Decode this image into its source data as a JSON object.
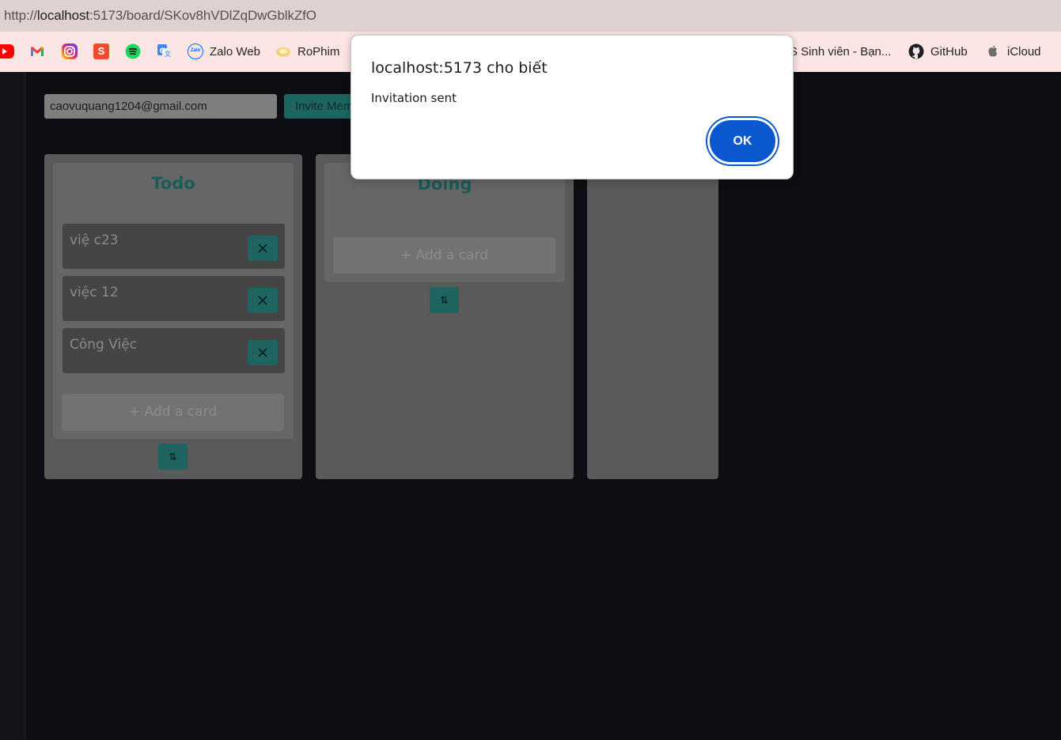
{
  "browser": {
    "url_scheme": "http://",
    "url_host": "localhost",
    "url_rest": ":5173/board/SKov8hVDlZqDwGblkZfO"
  },
  "bookmarks": [
    {
      "icon": "youtube-icon",
      "label": "",
      "color": "#ff0000"
    },
    {
      "icon": "gmail-icon",
      "label": "",
      "color": "#ea4335"
    },
    {
      "icon": "instagram-icon",
      "label": "",
      "color": "#d62976"
    },
    {
      "icon": "shopee-icon",
      "label": "",
      "color": "#ee4d2d"
    },
    {
      "icon": "spotify-icon",
      "label": "",
      "color": "#1ed760"
    },
    {
      "icon": "google-translate-icon",
      "label": "",
      "color": "#4285f4"
    },
    {
      "icon": "zalo-icon",
      "label": "Zalo Web",
      "color": "#0068ff"
    },
    {
      "icon": "rophim-icon",
      "label": "RoPhim",
      "color": "#f5d27a"
    },
    {
      "icon": "dhcp-icon",
      "label": "S Sinh viên - Bạn...",
      "color": "#fce6e4"
    },
    {
      "icon": "github-icon",
      "label": "GitHub",
      "color": "#1b1f23"
    },
    {
      "icon": "apple-icon",
      "label": "iCloud",
      "color": "#6e6e6e"
    }
  ],
  "invite": {
    "email_value": "caovuquang1204@gmail.com",
    "button_label": "Invite Mem"
  },
  "lists": [
    {
      "title": "Todo",
      "cards": [
        "việ c23",
        "việc 12",
        "Công Việc"
      ],
      "add_label": "+ Add a card",
      "drag_label": "⇅"
    },
    {
      "title": "Doing",
      "cards": [],
      "add_label": "+ Add a card",
      "drag_label": "⇅"
    }
  ],
  "dialog": {
    "title": "localhost:5173 cho biết",
    "message": "Invitation sent",
    "ok_label": "OK"
  },
  "colors": {
    "accent": "#1e6561",
    "dialog_button": "#0b57d0"
  }
}
